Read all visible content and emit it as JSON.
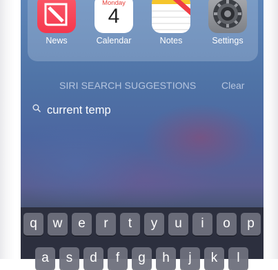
{
  "apps": [
    {
      "label": "News",
      "icon": "news-icon"
    },
    {
      "label": "Calendar",
      "icon": "calendar-icon",
      "weekday": "Monday",
      "date": "4"
    },
    {
      "label": "Notes",
      "icon": "notes-icon"
    },
    {
      "label": "Settings",
      "icon": "settings-gear-icon"
    }
  ],
  "search": {
    "section_title": "SIRI SEARCH SUGGESTIONS",
    "clear_label": "Clear",
    "suggestion": "current temp"
  },
  "keyboard": {
    "row1": [
      "q",
      "w",
      "e",
      "r",
      "t",
      "y",
      "u",
      "i",
      "o",
      "p"
    ],
    "row2": [
      "a",
      "s",
      "d",
      "f",
      "g",
      "h",
      "j",
      "k",
      "l"
    ]
  },
  "colors": {
    "news": "#f5374d",
    "calendar_accent": "#e5403a",
    "notes_accent": "#f5c52c",
    "keyboard_key": "#6e707c"
  }
}
